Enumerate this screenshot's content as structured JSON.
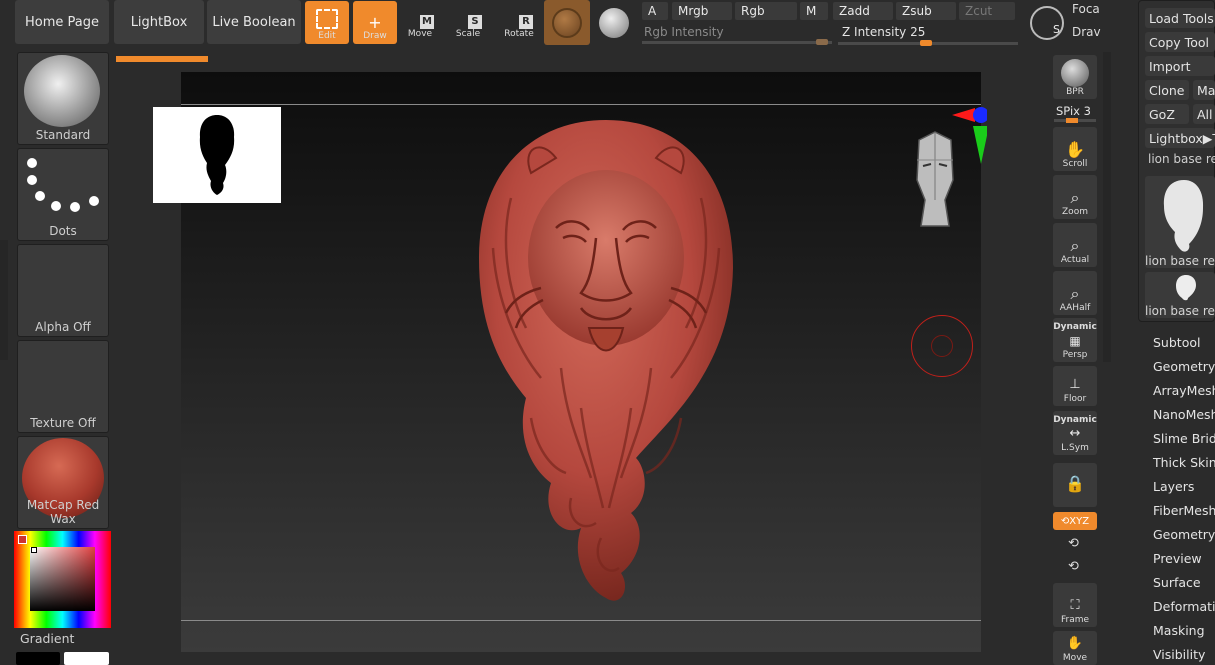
{
  "top_bar": {
    "home_page": "Home Page",
    "lightbox": "LightBox",
    "live_boolean": "Live Boolean",
    "edit": "Edit",
    "draw": "Draw",
    "move": "Move",
    "scale": "Scale",
    "rotate": "Rotate",
    "a": "A",
    "mrgb": "Mrgb",
    "rgb": "Rgb",
    "m": "M",
    "zadd": "Zadd",
    "zsub": "Zsub",
    "zcut": "Zcut",
    "rgb_intensity": "Rgb Intensity",
    "z_intensity": "Z Intensity 25",
    "focal": "Foca",
    "draw_size": "Drav"
  },
  "left_panel": {
    "brush": "Standard",
    "stroke": "Dots",
    "alpha": "Alpha Off",
    "texture": "Texture Off",
    "material": "MatCap Red Wax",
    "gradient": "Gradient"
  },
  "right_toolbar": {
    "bpr": "BPR",
    "spix": "SPix 3",
    "scroll": "Scroll",
    "zoom": "Zoom",
    "actual": "Actual",
    "aahalf": "AAHalf",
    "dynamic_persp": "Dynamic",
    "persp": "Persp",
    "floor": "Floor",
    "dynamic_lsym": "Dynamic",
    "lsym": "L.Sym",
    "xyz": "XYZ",
    "frame": "Frame",
    "move": "Move"
  },
  "right_panel": {
    "load_tool": "Load Tools F",
    "copy_tool": "Copy Tool",
    "import": "Import",
    "clone": "Clone",
    "make": "Ma",
    "goz": "GoZ",
    "all": "All",
    "lightbox_tools": "Lightbox▶T",
    "tool_name": "lion base reli",
    "thumb1": "lion base reli",
    "thumb2": "lion base reli",
    "menu": [
      "Subtool",
      "Geometry",
      "ArrayMesh",
      "NanoMesh",
      "Slime Bridg",
      "Thick Skin",
      "Layers",
      "FiberMesh",
      "Geometry H",
      "Preview",
      "Surface",
      "Deformatio",
      "Masking",
      "Visibility"
    ]
  },
  "colors": {
    "accent": "#f08a2c",
    "clay": "#b5483e"
  }
}
